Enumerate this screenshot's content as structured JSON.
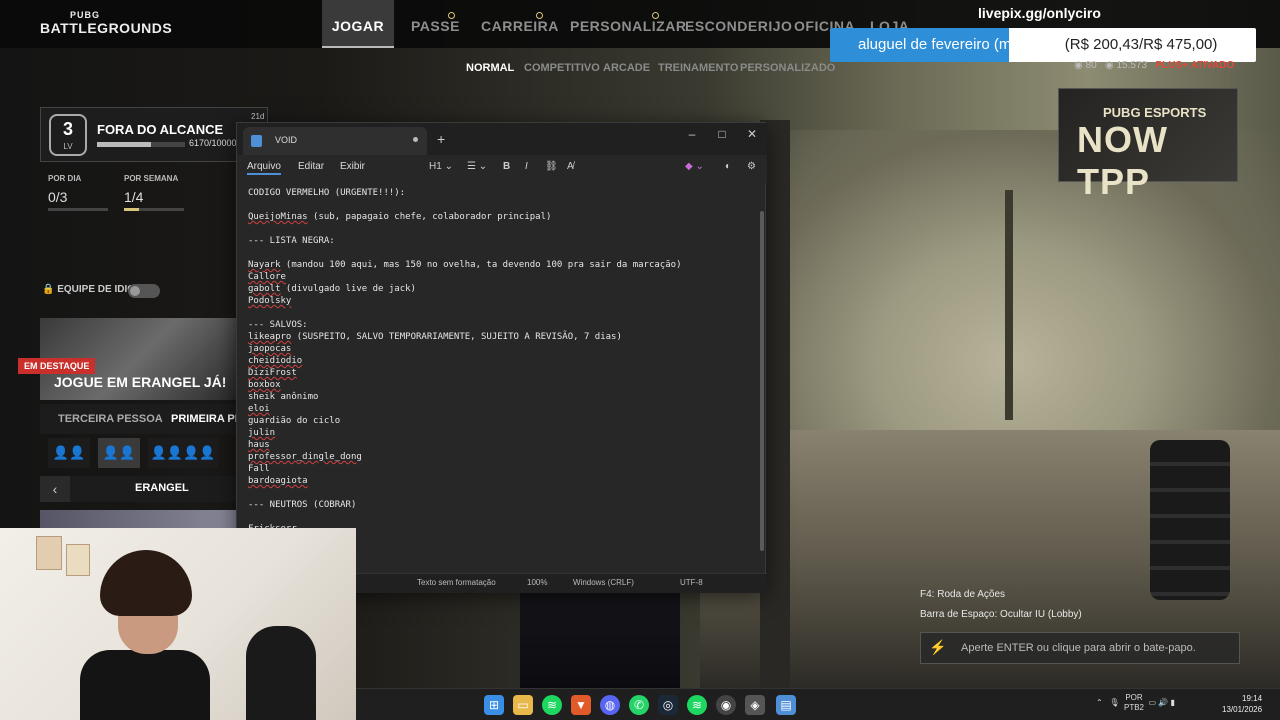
{
  "game": {
    "logo_top": "PUBG",
    "logo_bottom": "BATTLEGROUNDS",
    "nav_tabs": [
      {
        "label": "JOGAR",
        "active": true
      },
      {
        "label": "PASSE"
      },
      {
        "label": "CARREIRA"
      },
      {
        "label": "PERSONALIZAR"
      },
      {
        "label": "ESCONDERIJO"
      },
      {
        "label": "OFICINA"
      },
      {
        "label": "LOJA"
      }
    ],
    "sub_tabs": [
      "NORMAL",
      "COMPETITIVO",
      "ARCADE",
      "TREINAMENTO",
      "PERSONALIZADO"
    ],
    "currency_bp": "80",
    "currency_gcoin": "15.573",
    "plus_label": "PLUS+",
    "plus_status": "ATIVADO",
    "profile": {
      "level": "3",
      "level_label": "LV",
      "name": "FORA DO ALCANCE",
      "xp": "6170/10000",
      "xp_fraction": 0.617,
      "time": "21d"
    },
    "stats": [
      {
        "label": "POR DIA",
        "value": "0/3",
        "fraction": 0
      },
      {
        "label": "POR SEMANA",
        "value": "1/4",
        "fraction": 0.25
      }
    ],
    "language_team_label": "EQUIPE DE IDIOMA",
    "featured_badge": "EM DESTAQUE",
    "featured_title": "JOGUE EM ERANGEL JÁ!",
    "perspective": [
      "TERCEIRA PESSOA",
      "PRIMEIRA PESS"
    ],
    "squad_icons": [
      "👤👤",
      "👤👤",
      "👤👤👤👤"
    ],
    "map_name": "ERANGEL",
    "esports_top": "PUBG ESPORTS",
    "esports_main": "NOW TPP",
    "hint_f4": "F4: Roda de Ações",
    "hint_space": "Barra de Espaço: Ocultar IU (Lobby)",
    "chat_placeholder": "Aperte ENTER ou clique para abrir o bate-papo."
  },
  "stream": {
    "livepix": "livepix.gg/onlyciro",
    "donation_label": "aluguel de fevereiro (mi ajude)",
    "donation_amount": "(R$ 200,43/R$ 475,00)",
    "donation_progress": 0.42
  },
  "notepad": {
    "tab_name": "VOID",
    "menu": [
      "Arquivo",
      "Editar",
      "Exibir"
    ],
    "heading_btn": "H1",
    "lines": [
      "CODIGO VERMELHO (URGENTE!!!):",
      "",
      "QueijoMinas (sub, papagaio chefe, colaborador principal)",
      "",
      "--- LISTA NEGRA:",
      "",
      "Nayark (mandou 100 aqui, mas 150 no ovelha, ta devendo 100 pra sair da marcação)",
      "Callore",
      "gabolt (divulgado live de jack)",
      "Podolsky",
      "",
      "--- SALVOS:",
      "likeapro (SUSPEITO, SALVO TEMPORARIAMENTE, SUJEITO A REVISÃO, 7 dias)",
      "jaopocas",
      "cheidiodio",
      "DiziFrost",
      "boxbox",
      "sheik anônimo",
      "eloi",
      "guardião do ciclo",
      "julin",
      "haus",
      "professor_dingle_dong",
      "Fall",
      "bardoagiota",
      "",
      "--- NEUTROS (COBRAR)",
      "",
      "Fricksorr"
    ],
    "status": {
      "format": "Texto sem formatação",
      "zoom": "100%",
      "line_ending": "Windows (CRLF)",
      "encoding": "UTF-8"
    }
  },
  "taskbar": {
    "lang_1": "POR",
    "lang_2": "PTB2",
    "time": "19:14",
    "date": "13/01/2026"
  }
}
